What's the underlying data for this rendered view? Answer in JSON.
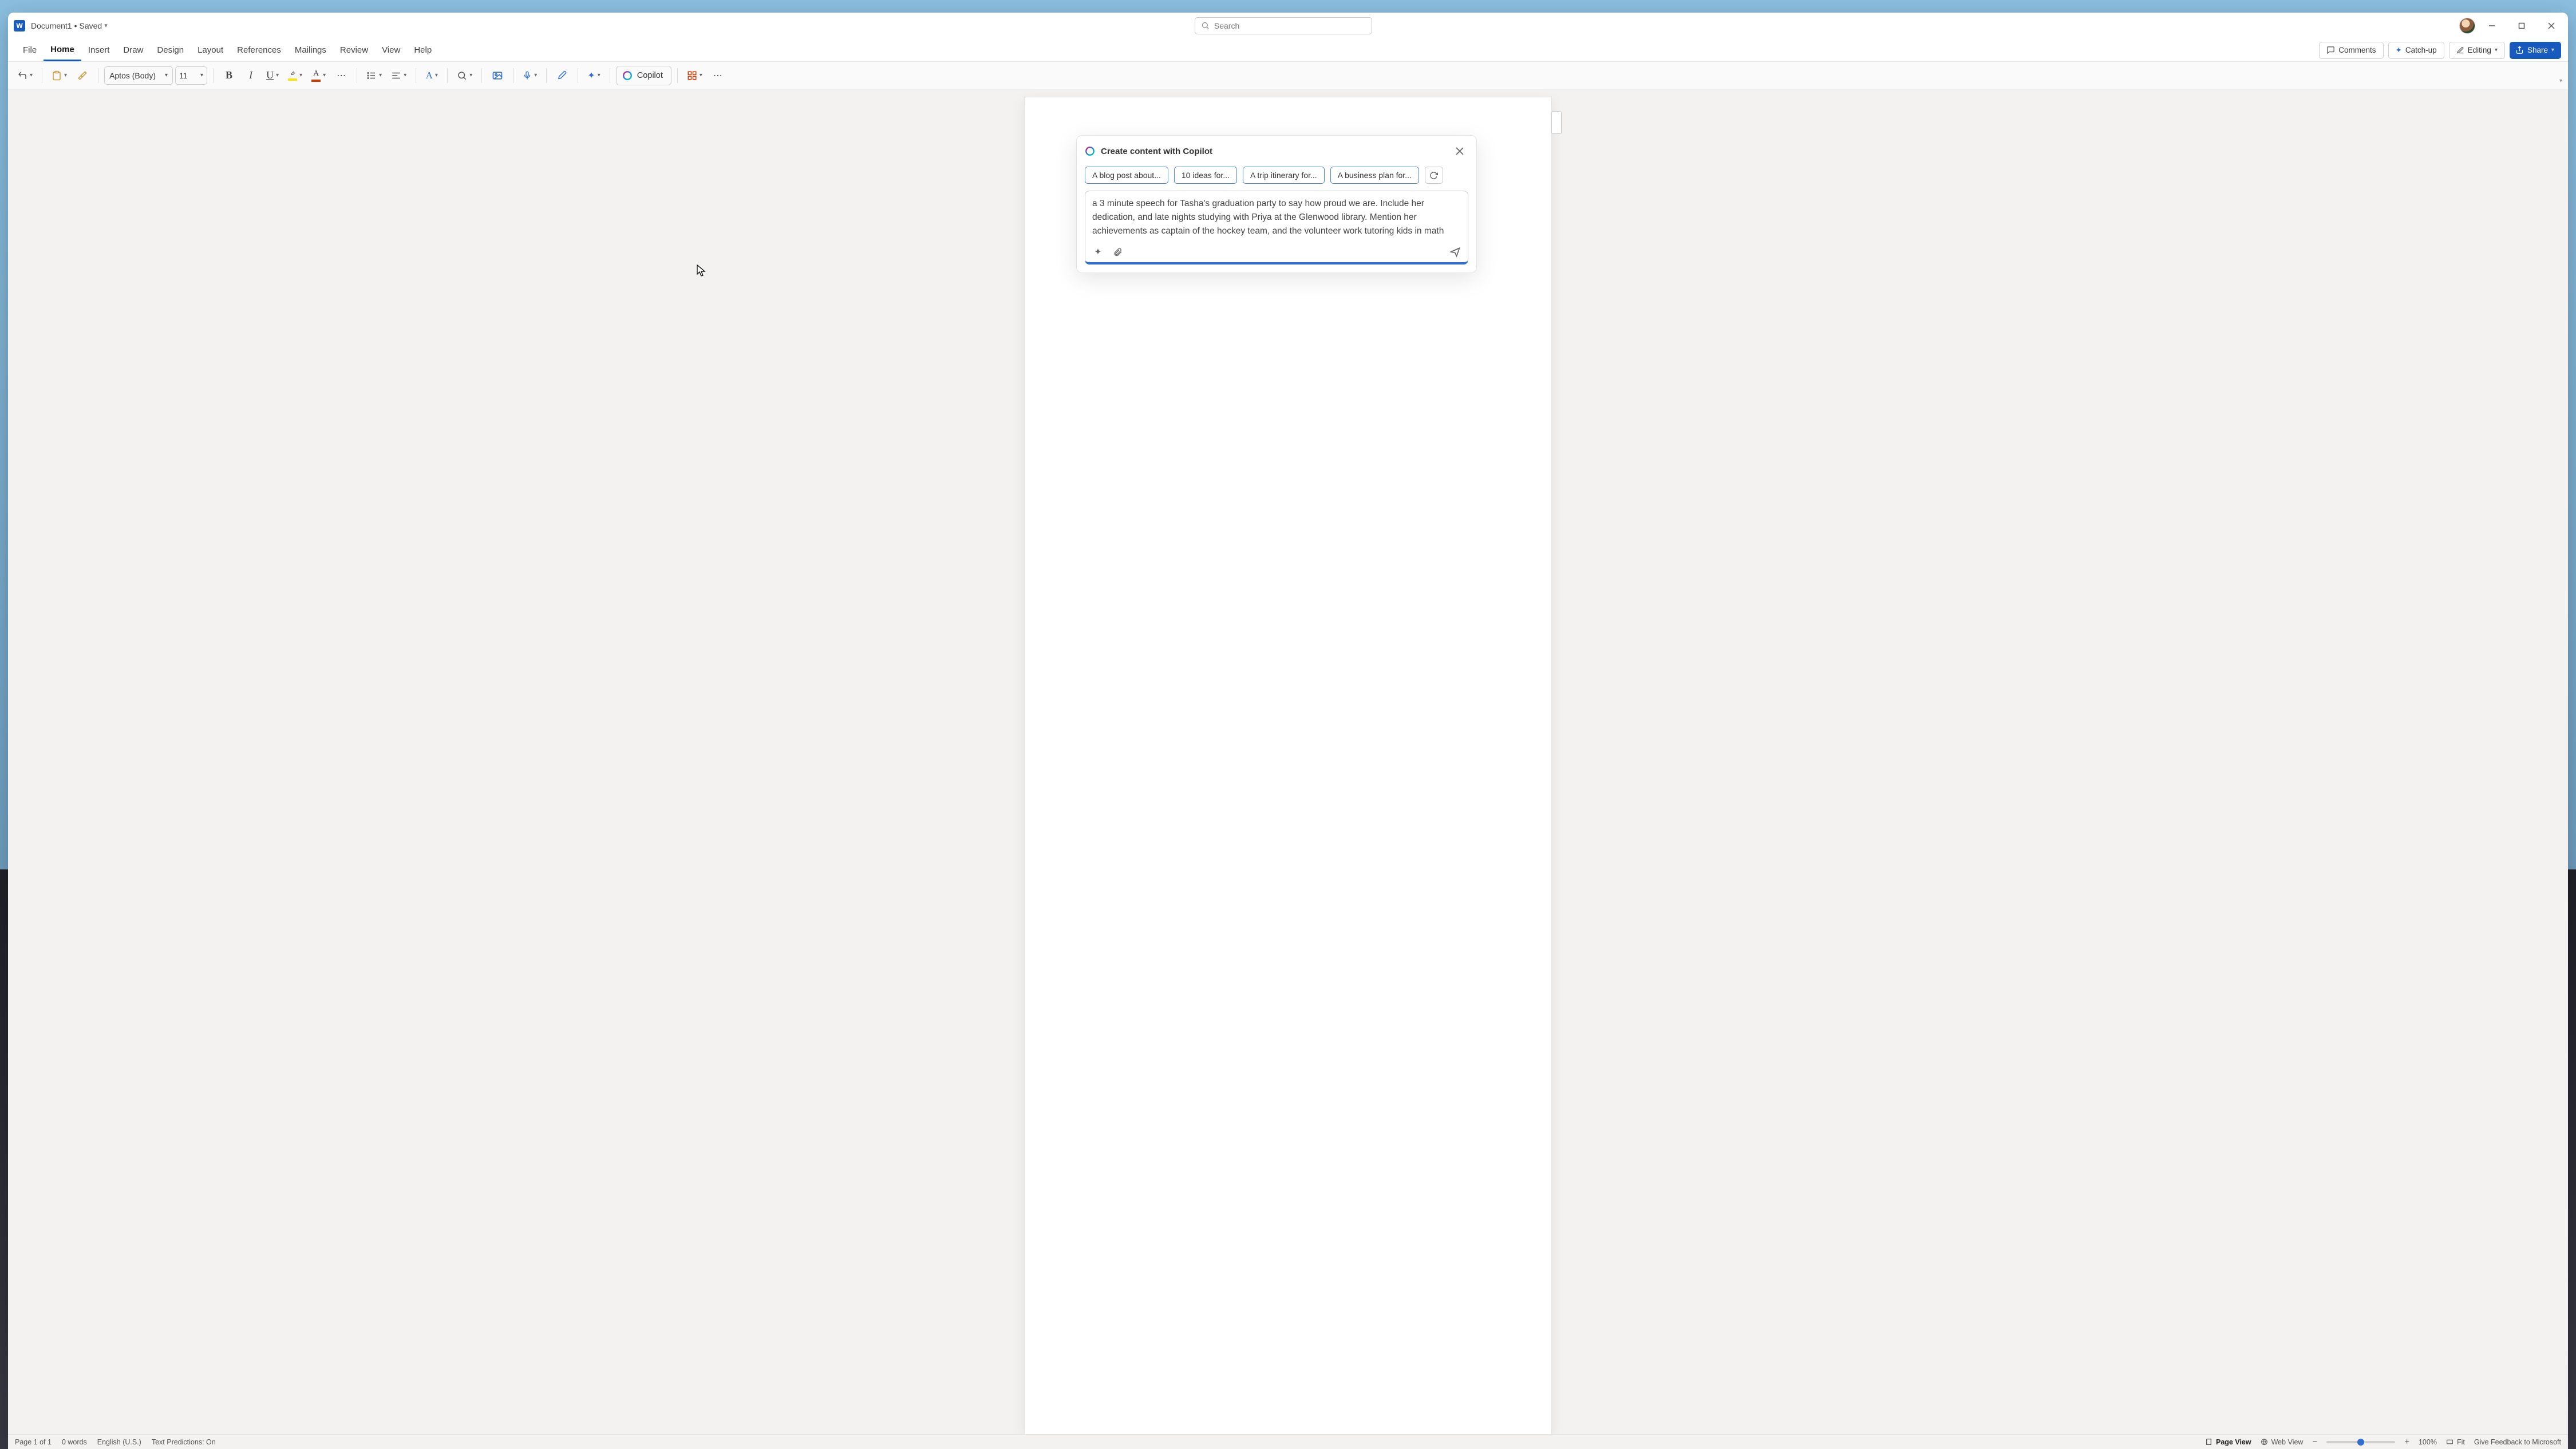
{
  "title": {
    "doc": "Document1",
    "status": "Saved"
  },
  "search": {
    "placeholder": "Search"
  },
  "tabs": [
    "File",
    "Home",
    "Insert",
    "Draw",
    "Design",
    "Layout",
    "References",
    "Mailings",
    "Review",
    "View",
    "Help"
  ],
  "active_tab": "Home",
  "header_buttons": {
    "comments": "Comments",
    "catchup": "Catch-up",
    "editing": "Editing",
    "share": "Share"
  },
  "ribbon": {
    "font": "Aptos (Body)",
    "size": "11",
    "copilot": "Copilot"
  },
  "copilot_dialog": {
    "title": "Create content with Copilot",
    "chips": [
      "A blog post about...",
      "10 ideas for...",
      "A trip itinerary for...",
      "A business plan for..."
    ],
    "prompt": "a 3 minute speech for Tasha's graduation party to say how proud we are. Include her dedication, and late nights studying with Priya at the Glenwood library. Mention her achievements as captain of the hockey team, and the volunteer work tutoring kids in math"
  },
  "status": {
    "page": "Page 1 of 1",
    "words": "0 words",
    "lang": "English (U.S.)",
    "predictions": "Text Predictions: On",
    "pageview": "Page View",
    "webview": "Web View",
    "zoom": "100%",
    "fit": "Fit",
    "feedback": "Give Feedback to Microsoft"
  }
}
